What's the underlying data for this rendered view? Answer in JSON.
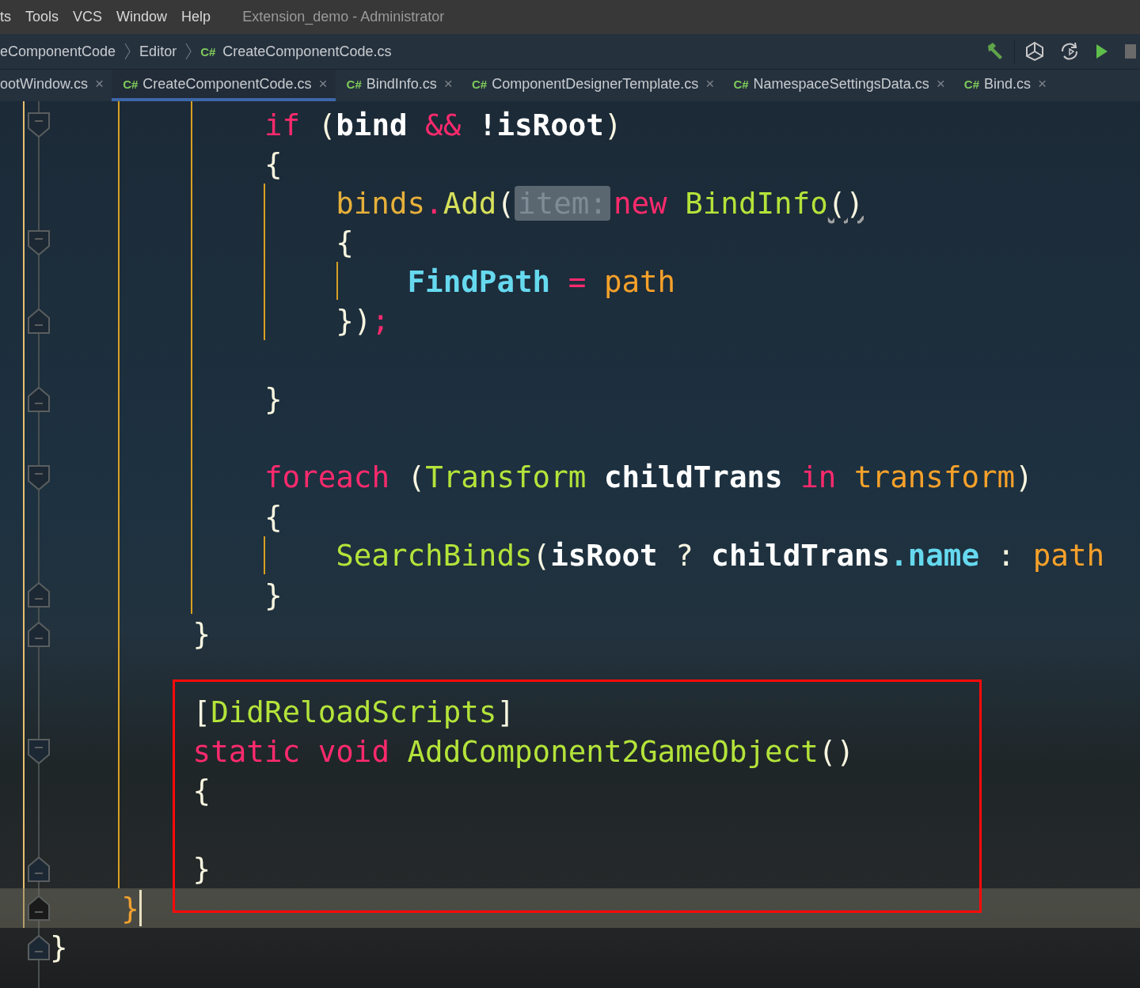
{
  "menu_bar": {
    "items": [
      {
        "label": "ts"
      },
      {
        "label": "Tools"
      },
      {
        "label": "VCS"
      },
      {
        "label": "Window"
      },
      {
        "label": "Help"
      }
    ],
    "title": "Extension_demo - Administrator"
  },
  "breadcrumbs": [
    {
      "label": "eComponentCode"
    },
    {
      "label": "Editor"
    },
    {
      "badge": "C#",
      "label": "CreateComponentCode.cs"
    }
  ],
  "toolbar": [
    {
      "kind": "build"
    },
    {
      "kind": "unity"
    },
    {
      "kind": "refresh"
    },
    {
      "kind": "play"
    },
    {
      "kind": "stop"
    }
  ],
  "tabs": [
    {
      "label": "ootWindow.cs",
      "close": "×",
      "selected": false
    },
    {
      "badge": "C#",
      "label": "CreateComponentCode.cs",
      "close": "×",
      "selected": true
    },
    {
      "badge": "C#",
      "label": "BindInfo.cs",
      "close": "×",
      "selected": false
    },
    {
      "badge": "C#",
      "label": "ComponentDesignerTemplate.cs",
      "close": "×",
      "selected": false
    },
    {
      "badge": "C#",
      "label": "NamespaceSettingsData.cs",
      "close": "×",
      "selected": false
    },
    {
      "badge": "C#",
      "label": "Bind.cs",
      "close": "×",
      "selected": false
    }
  ],
  "code_lines": [
    {
      "children": [
        {
          "children": [
            {
              "children": [
                {
                  "fold_start": true,
                  "fold_end": false,
                  "current": false,
                  "framed": false,
                  "tokens": [
                    {
                      "t": "if",
                      "kind": "keyword"
                    },
                    {
                      "t": " (",
                      "kind": "punct"
                    },
                    {
                      "t": "bind",
                      "kind": "local"
                    },
                    {
                      "t": " && ",
                      "kind": "op"
                    },
                    {
                      "t": "!isRoot",
                      "kind": "local"
                    },
                    {
                      "t": ")",
                      "kind": "punct"
                    }
                  ]
                },
                {
                  "fold_start": false,
                  "fold_end": false,
                  "current": false,
                  "framed": false,
                  "tokens": [
                    {
                      "t": "{",
                      "kind": "punct"
                    }
                  ],
                  "children": [
                    {
                      "fold_start": false,
                      "fold_end": false,
                      "current": false,
                      "framed": false,
                      "tokens": [
                        {
                          "t": "binds",
                          "kind": "field"
                        },
                        {
                          "t": ".",
                          "kind": "op"
                        },
                        {
                          "t": "Add",
                          "kind": "method"
                        },
                        {
                          "t": "(",
                          "kind": "punct"
                        },
                        {
                          "t": "item:",
                          "kind": "hint"
                        },
                        {
                          "t": "new",
                          "kind": "keyword"
                        },
                        {
                          "t": " BindInfo",
                          "kind": "type"
                        },
                        {
                          "t": "()",
                          "kind": "warn"
                        }
                      ]
                    },
                    {
                      "fold_start": true,
                      "fold_end": false,
                      "current": false,
                      "framed": false,
                      "tokens": [
                        {
                          "t": "{",
                          "kind": "punct"
                        }
                      ],
                      "children": [
                        {
                          "fold_start": false,
                          "fold_end": false,
                          "current": false,
                          "framed": false,
                          "tokens": [
                            {
                              "t": "FindPath",
                              "kind": "property"
                            },
                            {
                              "t": " = ",
                              "kind": "op"
                            },
                            {
                              "t": "path",
                              "kind": "param"
                            }
                          ]
                        }
                      ]
                    },
                    {
                      "fold_start": false,
                      "fold_end": true,
                      "current": false,
                      "framed": false,
                      "tokens": [
                        {
                          "t": "})",
                          "kind": "punct"
                        },
                        {
                          "t": ";",
                          "kind": "op"
                        }
                      ]
                    },
                    {
                      "fold_start": false,
                      "fold_end": false,
                      "current": false,
                      "framed": false
                    }
                  ]
                },
                {
                  "fold_start": false,
                  "fold_end": true,
                  "current": false,
                  "framed": false,
                  "tokens": [
                    {
                      "t": "}",
                      "kind": "punct"
                    }
                  ]
                },
                {
                  "fold_start": false,
                  "fold_end": false,
                  "current": false,
                  "framed": false
                },
                {
                  "fold_start": true,
                  "fold_end": false,
                  "current": false,
                  "framed": false,
                  "tokens": [
                    {
                      "t": "foreach",
                      "kind": "keyword"
                    },
                    {
                      "t": " (",
                      "kind": "punct"
                    },
                    {
                      "t": "Transform",
                      "kind": "type"
                    },
                    {
                      "t": " childTrans ",
                      "kind": "local"
                    },
                    {
                      "t": "in",
                      "kind": "keyword"
                    },
                    {
                      "t": " transform",
                      "kind": "param"
                    },
                    {
                      "t": ")",
                      "kind": "punct"
                    }
                  ]
                },
                {
                  "fold_start": false,
                  "fold_end": false,
                  "current": false,
                  "framed": false,
                  "tokens": [
                    {
                      "t": "{",
                      "kind": "punct"
                    }
                  ],
                  "children": [
                    {
                      "fold_start": false,
                      "fold_end": false,
                      "current": false,
                      "framed": false,
                      "tokens": [
                        {
                          "t": "SearchBinds",
                          "kind": "type"
                        },
                        {
                          "t": "(",
                          "kind": "punct"
                        },
                        {
                          "t": "isRoot",
                          "kind": "local"
                        },
                        {
                          "t": " ? ",
                          "kind": "punct"
                        },
                        {
                          "t": "childTrans",
                          "kind": "local"
                        },
                        {
                          "t": ".",
                          "kind": "property"
                        },
                        {
                          "t": "name",
                          "kind": "property"
                        },
                        {
                          "t": " : ",
                          "kind": "punct"
                        },
                        {
                          "t": "path",
                          "kind": "param"
                        }
                      ]
                    }
                  ]
                },
                {
                  "fold_start": false,
                  "fold_end": true,
                  "current": false,
                  "framed": false,
                  "tokens": [
                    {
                      "t": "}",
                      "kind": "punct"
                    }
                  ]
                }
              ]
            },
            {
              "fold_start": false,
              "fold_end": true,
              "current": false,
              "framed": false,
              "tokens": [
                {
                  "t": "}",
                  "kind": "punct"
                }
              ]
            },
            {
              "fold_start": false,
              "fold_end": false,
              "current": false,
              "framed": false
            },
            {
              "fold_start": false,
              "fold_end": false,
              "current": false,
              "framed": true,
              "tokens": [
                {
                  "t": "[",
                  "kind": "punct"
                },
                {
                  "t": "DidReloadScripts",
                  "kind": "type"
                },
                {
                  "t": "]",
                  "kind": "punct"
                }
              ]
            },
            {
              "fold_start": true,
              "fold_end": false,
              "current": false,
              "framed": true,
              "tokens": [
                {
                  "t": "static void ",
                  "kind": "keyword"
                },
                {
                  "t": "AddComponent2GameObject",
                  "kind": "type"
                },
                {
                  "t": "()",
                  "kind": "punct"
                }
              ]
            },
            {
              "fold_start": false,
              "fold_end": false,
              "current": false,
              "framed": true,
              "tokens": [
                {
                  "t": "{",
                  "kind": "punct"
                }
              ],
              "children": [
                {
                  "fold_start": false,
                  "fold_end": false,
                  "current": false,
                  "framed": true
                }
              ]
            },
            {
              "fold_start": false,
              "fold_end": true,
              "current": false,
              "framed": true,
              "tokens": [
                {
                  "t": "}",
                  "kind": "punct"
                }
              ]
            }
          ]
        },
        {
          "fold_start": false,
          "fold_end": true,
          "current": true,
          "framed": false,
          "tokens": [
            {
              "t": "}",
              "kind": "match"
            }
          ]
        }
      ]
    },
    {
      "fold_start": false,
      "fold_end": true,
      "current": false,
      "framed": false,
      "tokens": [
        {
          "t": "}",
          "kind": "punct"
        }
      ]
    }
  ]
}
